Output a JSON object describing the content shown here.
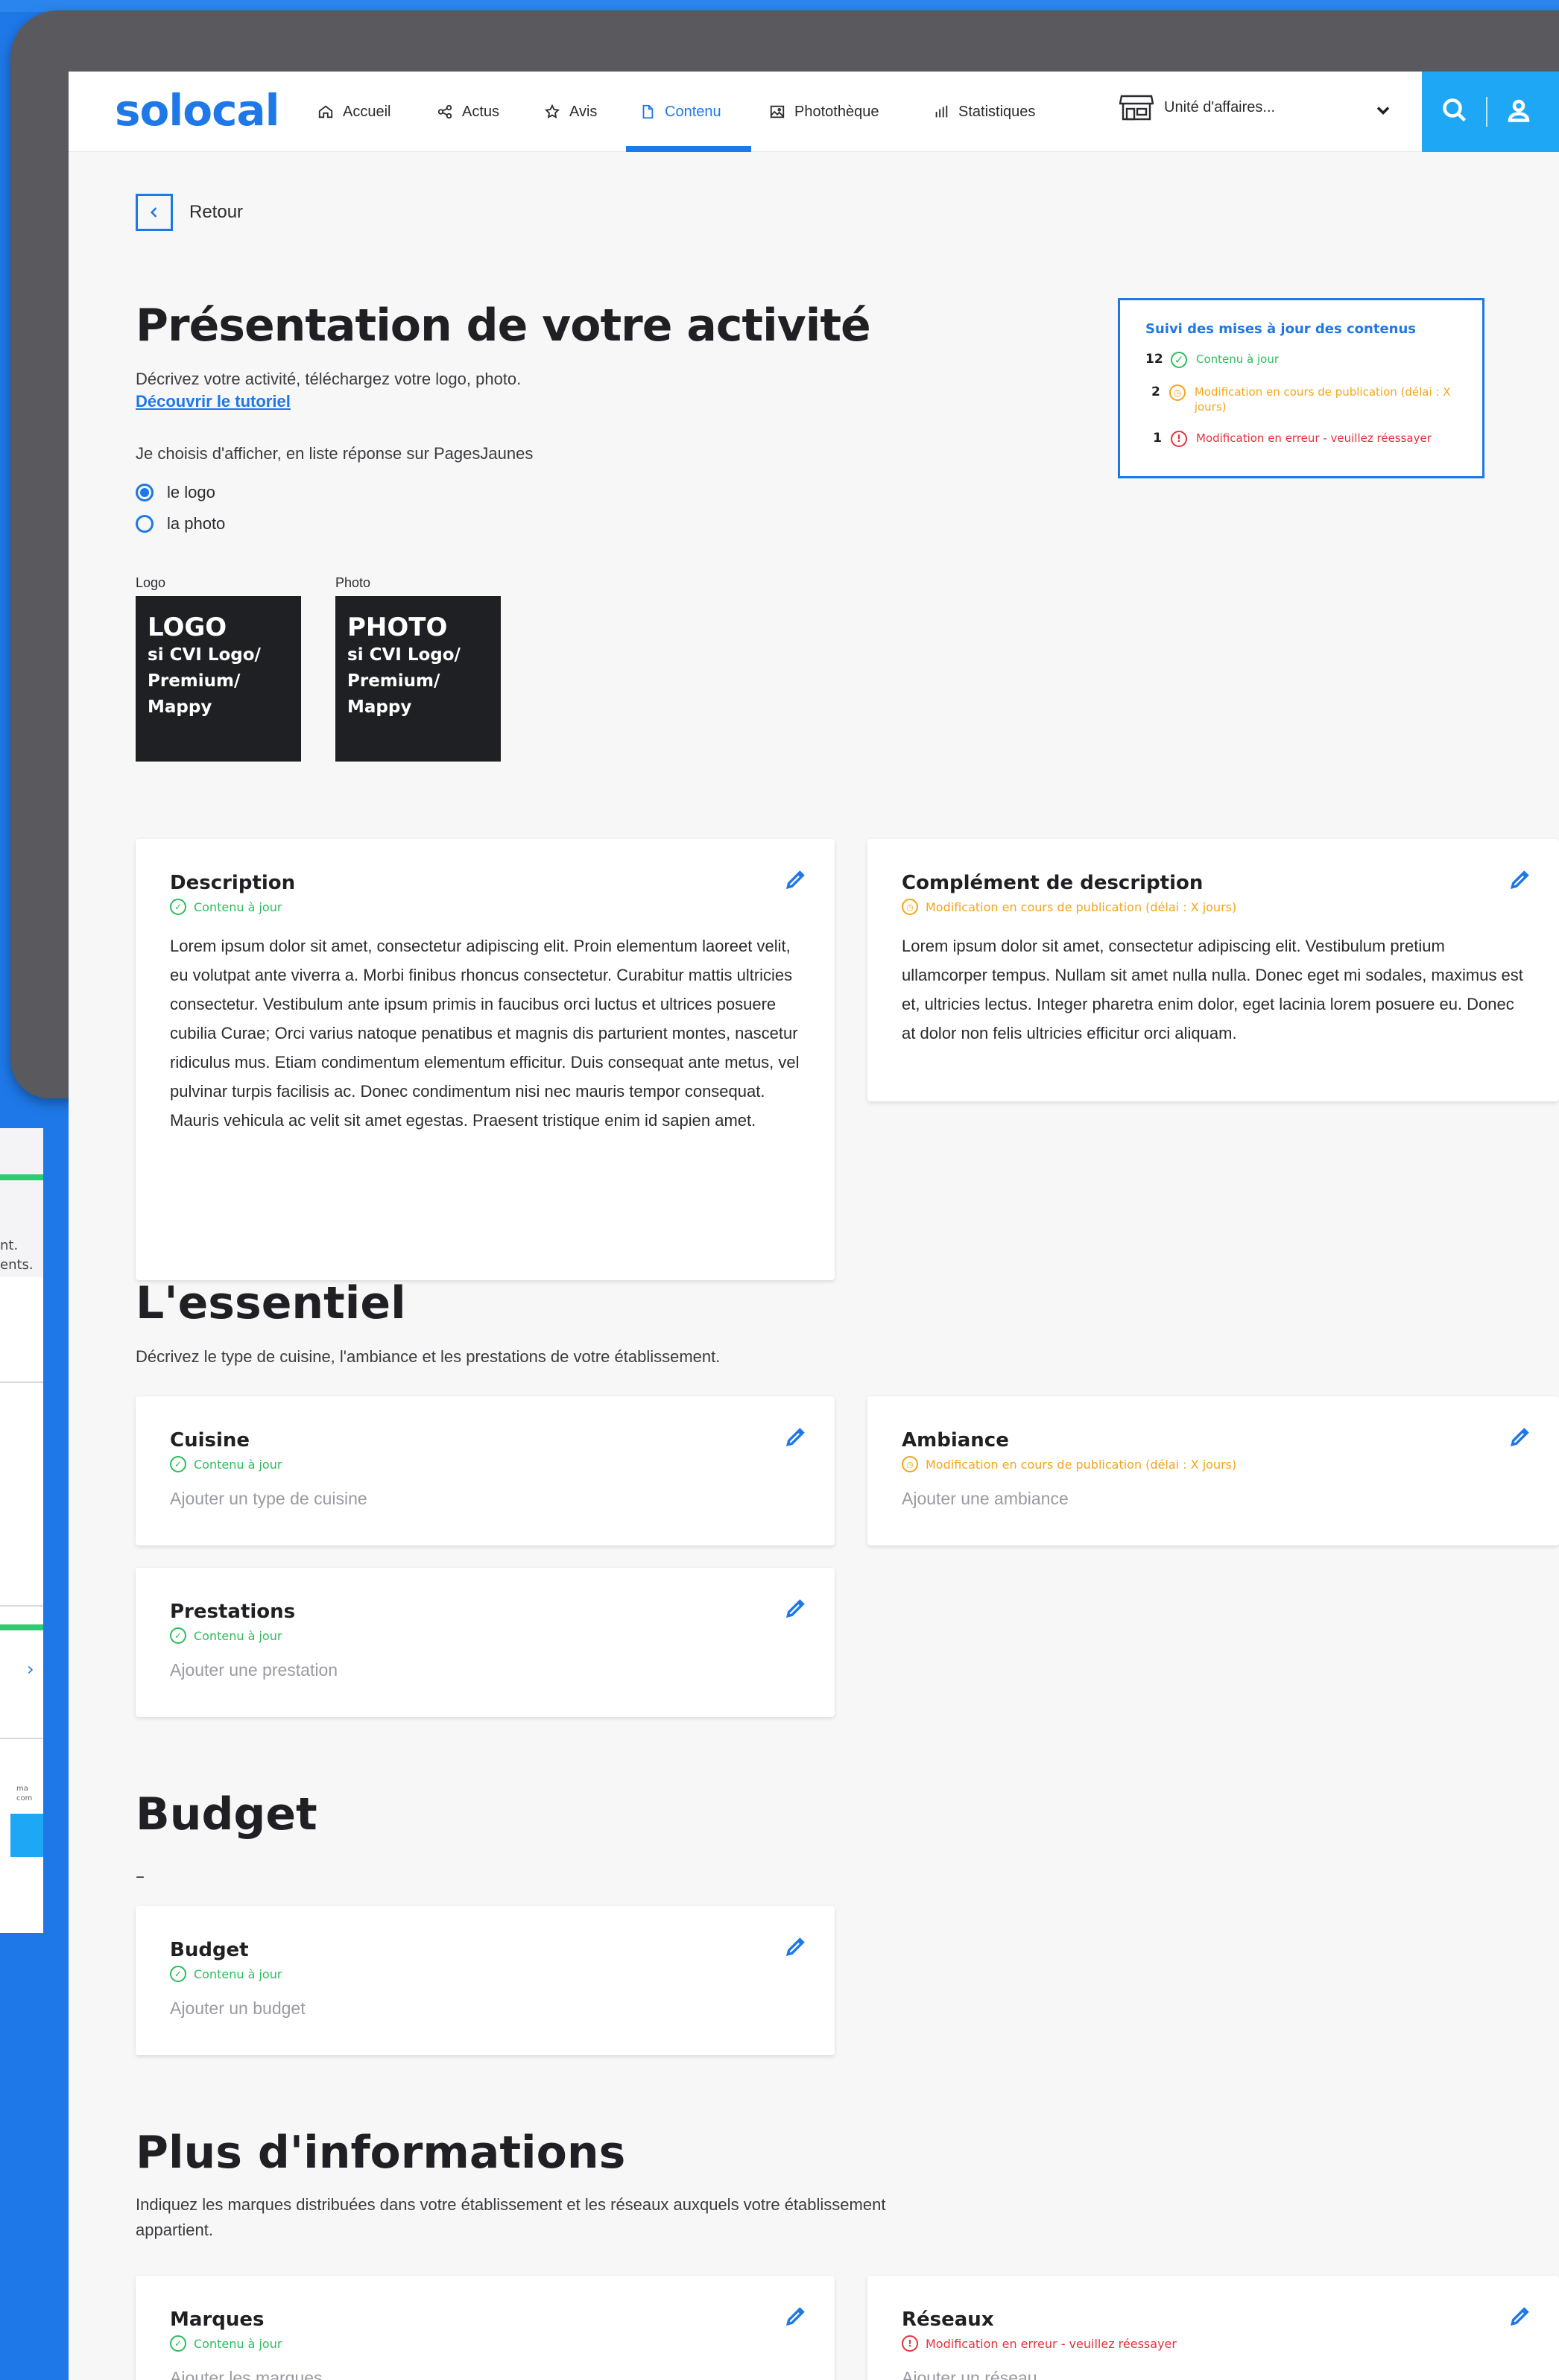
{
  "nav": {
    "logo": "solocal",
    "items": [
      {
        "label": "Accueil",
        "icon": "home-icon"
      },
      {
        "label": "Actus",
        "icon": "share-icon"
      },
      {
        "label": "Avis",
        "icon": "star-icon"
      },
      {
        "label": "Contenu",
        "icon": "document-icon",
        "active": true
      },
      {
        "label": "Photothèque",
        "icon": "image-icon"
      },
      {
        "label": "Statistiques",
        "icon": "bar-chart-icon"
      }
    ],
    "business_unit": "Unité d'affaires...",
    "accent": "#1E78E8",
    "search_bg": "#1EA7F5"
  },
  "back_label": "Retour",
  "presentation": {
    "title": "Présentation de votre activité",
    "subtitle": "Décrivez votre activité, téléchargez votre logo, photo.",
    "tutorial_link": "Découvrir le tutoriel",
    "choose_text": "Je choisis d'afficher,  en liste réponse sur PagesJaunes",
    "options": [
      "le logo",
      "la photo"
    ],
    "selected_option": "le logo",
    "logo_label": "Logo",
    "logo_title": "LOGO",
    "logo_sub": "si CVI Logo/\nPremium/\nMappy",
    "photo_label": "Photo",
    "photo_title": "PHOTO",
    "photo_sub": "si CVI Logo/\nPremium/\nMappy"
  },
  "suivi": {
    "title": "Suivi des mises à jour des contenus",
    "rows": [
      {
        "count": "12",
        "text": "Contenu à jour",
        "status": "ok"
      },
      {
        "count": "2",
        "text": "Modification en cours de publication (délai : X jours)",
        "status": "pending"
      },
      {
        "count": "1",
        "text": "Modification en erreur - veuillez réessayer",
        "status": "error"
      }
    ]
  },
  "status": {
    "ok": "Contenu à jour",
    "pending": "Modification en cours de publication (délai : X jours)",
    "error": "Modification en erreur - veuillez réessayer",
    "colors": {
      "ok": "#2DBD5C",
      "pending": "#F5A519",
      "error": "#E5323C"
    }
  },
  "cards": {
    "description": {
      "title": "Description",
      "body": "Lorem ipsum dolor sit amet, consectetur adipiscing elit. Proin elementum laoreet velit, eu volutpat ante viverra a. Morbi finibus rhoncus consectetur. Curabitur mattis ultricies consectetur. Vestibulum ante ipsum primis in faucibus orci luctus et ultrices posuere cubilia Curae; Orci varius natoque penatibus et magnis dis parturient montes, nascetur ridiculus mus. Etiam condimentum elementum efficitur. Duis consequat ante metus, vel pulvinar turpis facilisis ac. Donec condimentum nisi nec mauris tempor consequat. Mauris vehicula ac velit sit amet egestas. Praesent tristique enim id sapien amet."
    },
    "complement": {
      "title": "Complément de description",
      "body": "Lorem ipsum dolor sit amet, consectetur adipiscing elit. Vestibulum pretium ullamcorper tempus. Nullam sit amet nulla nulla. Donec eget mi sodales, maximus est et, ultricies lectus. Integer pharetra enim dolor, eget lacinia lorem posuere eu. Donec at dolor non felis ultricies efficitur orci aliquam."
    },
    "cuisine": {
      "title": "Cuisine",
      "placeholder": "Ajouter un type de cuisine"
    },
    "ambiance": {
      "title": "Ambiance",
      "placeholder": "Ajouter une ambiance"
    },
    "prestations": {
      "title": "Prestations",
      "placeholder": "Ajouter une prestation"
    },
    "budget": {
      "title": "Budget",
      "placeholder": "Ajouter un budget"
    },
    "marques": {
      "title": "Marques",
      "placeholder": "Ajouter les marques"
    },
    "reseaux": {
      "title": "Réseaux",
      "placeholder": "Ajouter un réseau"
    }
  },
  "sections": {
    "essentiel": {
      "title": "L'essentiel",
      "subtitle": "Décrivez le type de cuisine, l'ambiance et les prestations de votre établissement."
    },
    "budget": {
      "title": "Budget",
      "dash": "–"
    },
    "plus": {
      "title": "Plus d'informations",
      "subtitle": "Indiquez les marques distribuées dans votre établissement et les réseaux auxquels votre établissement appartient."
    }
  },
  "background_fragments": {
    "text1": "nt.",
    "text2": "ents.",
    "small": "ma com"
  }
}
